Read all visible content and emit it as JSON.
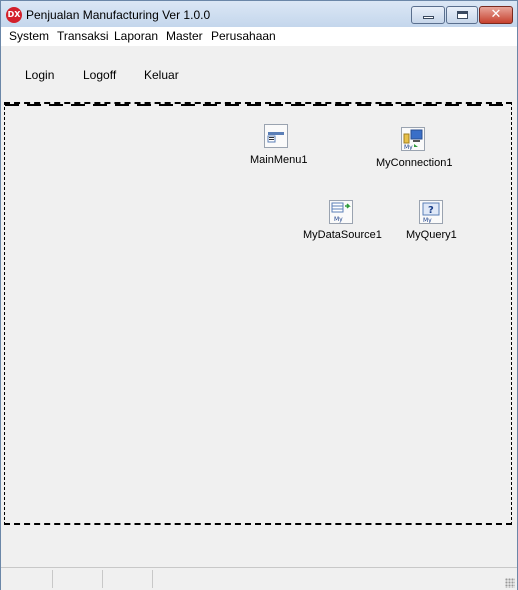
{
  "window": {
    "title": "Penjualan Manufacturing Ver 1.0.0",
    "app_icon_text": "DX",
    "close_glyph": "✕"
  },
  "menu": {
    "items": [
      {
        "label": "System"
      },
      {
        "label": "Transaksi"
      },
      {
        "label": "Laporan"
      },
      {
        "label": "Master"
      },
      {
        "label": "Perusahaan"
      }
    ]
  },
  "toolbar": {
    "login": "Login",
    "logoff": "Logoff",
    "keluar": "Keluar"
  },
  "components": [
    {
      "label": "MainMenu1",
      "icon": "main-menu-icon"
    },
    {
      "label": "MyConnection1",
      "icon": "connection-icon"
    },
    {
      "label": "MyDataSource1",
      "icon": "data-source-icon"
    },
    {
      "label": "MyQuery1",
      "icon": "query-icon"
    }
  ],
  "colors": {
    "close_button": "#c7412e",
    "app_icon": "#d3202a"
  }
}
